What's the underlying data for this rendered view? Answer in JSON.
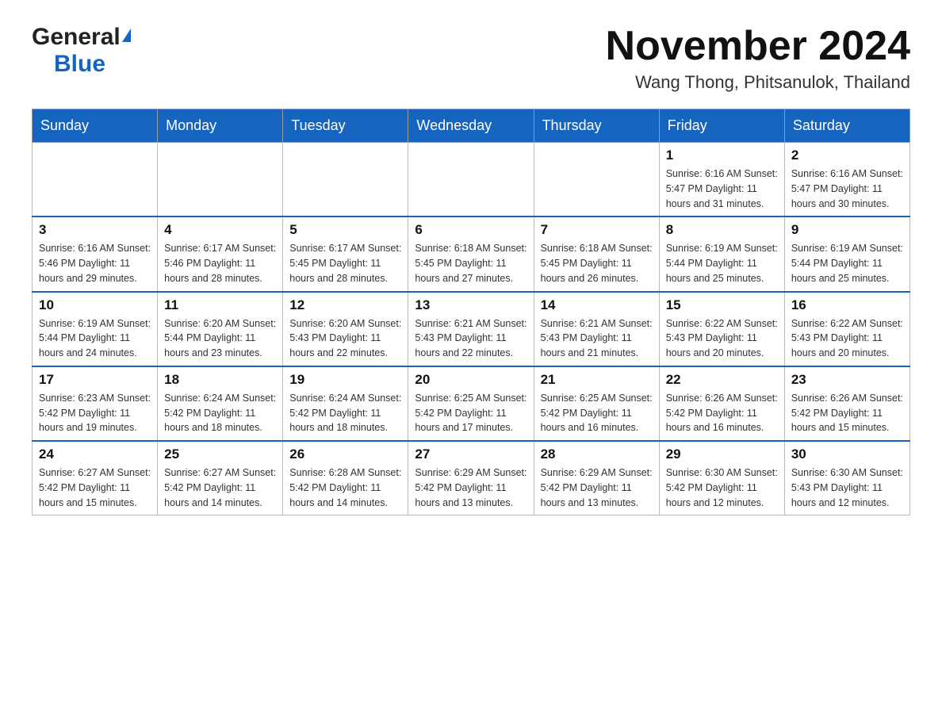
{
  "header": {
    "logo_general": "General",
    "logo_blue": "Blue",
    "month_title": "November 2024",
    "location": "Wang Thong, Phitsanulok, Thailand"
  },
  "weekdays": [
    "Sunday",
    "Monday",
    "Tuesday",
    "Wednesday",
    "Thursday",
    "Friday",
    "Saturday"
  ],
  "weeks": [
    [
      {
        "day": "",
        "info": ""
      },
      {
        "day": "",
        "info": ""
      },
      {
        "day": "",
        "info": ""
      },
      {
        "day": "",
        "info": ""
      },
      {
        "day": "",
        "info": ""
      },
      {
        "day": "1",
        "info": "Sunrise: 6:16 AM\nSunset: 5:47 PM\nDaylight: 11 hours\nand 31 minutes."
      },
      {
        "day": "2",
        "info": "Sunrise: 6:16 AM\nSunset: 5:47 PM\nDaylight: 11 hours\nand 30 minutes."
      }
    ],
    [
      {
        "day": "3",
        "info": "Sunrise: 6:16 AM\nSunset: 5:46 PM\nDaylight: 11 hours\nand 29 minutes."
      },
      {
        "day": "4",
        "info": "Sunrise: 6:17 AM\nSunset: 5:46 PM\nDaylight: 11 hours\nand 28 minutes."
      },
      {
        "day": "5",
        "info": "Sunrise: 6:17 AM\nSunset: 5:45 PM\nDaylight: 11 hours\nand 28 minutes."
      },
      {
        "day": "6",
        "info": "Sunrise: 6:18 AM\nSunset: 5:45 PM\nDaylight: 11 hours\nand 27 minutes."
      },
      {
        "day": "7",
        "info": "Sunrise: 6:18 AM\nSunset: 5:45 PM\nDaylight: 11 hours\nand 26 minutes."
      },
      {
        "day": "8",
        "info": "Sunrise: 6:19 AM\nSunset: 5:44 PM\nDaylight: 11 hours\nand 25 minutes."
      },
      {
        "day": "9",
        "info": "Sunrise: 6:19 AM\nSunset: 5:44 PM\nDaylight: 11 hours\nand 25 minutes."
      }
    ],
    [
      {
        "day": "10",
        "info": "Sunrise: 6:19 AM\nSunset: 5:44 PM\nDaylight: 11 hours\nand 24 minutes."
      },
      {
        "day": "11",
        "info": "Sunrise: 6:20 AM\nSunset: 5:44 PM\nDaylight: 11 hours\nand 23 minutes."
      },
      {
        "day": "12",
        "info": "Sunrise: 6:20 AM\nSunset: 5:43 PM\nDaylight: 11 hours\nand 22 minutes."
      },
      {
        "day": "13",
        "info": "Sunrise: 6:21 AM\nSunset: 5:43 PM\nDaylight: 11 hours\nand 22 minutes."
      },
      {
        "day": "14",
        "info": "Sunrise: 6:21 AM\nSunset: 5:43 PM\nDaylight: 11 hours\nand 21 minutes."
      },
      {
        "day": "15",
        "info": "Sunrise: 6:22 AM\nSunset: 5:43 PM\nDaylight: 11 hours\nand 20 minutes."
      },
      {
        "day": "16",
        "info": "Sunrise: 6:22 AM\nSunset: 5:43 PM\nDaylight: 11 hours\nand 20 minutes."
      }
    ],
    [
      {
        "day": "17",
        "info": "Sunrise: 6:23 AM\nSunset: 5:42 PM\nDaylight: 11 hours\nand 19 minutes."
      },
      {
        "day": "18",
        "info": "Sunrise: 6:24 AM\nSunset: 5:42 PM\nDaylight: 11 hours\nand 18 minutes."
      },
      {
        "day": "19",
        "info": "Sunrise: 6:24 AM\nSunset: 5:42 PM\nDaylight: 11 hours\nand 18 minutes."
      },
      {
        "day": "20",
        "info": "Sunrise: 6:25 AM\nSunset: 5:42 PM\nDaylight: 11 hours\nand 17 minutes."
      },
      {
        "day": "21",
        "info": "Sunrise: 6:25 AM\nSunset: 5:42 PM\nDaylight: 11 hours\nand 16 minutes."
      },
      {
        "day": "22",
        "info": "Sunrise: 6:26 AM\nSunset: 5:42 PM\nDaylight: 11 hours\nand 16 minutes."
      },
      {
        "day": "23",
        "info": "Sunrise: 6:26 AM\nSunset: 5:42 PM\nDaylight: 11 hours\nand 15 minutes."
      }
    ],
    [
      {
        "day": "24",
        "info": "Sunrise: 6:27 AM\nSunset: 5:42 PM\nDaylight: 11 hours\nand 15 minutes."
      },
      {
        "day": "25",
        "info": "Sunrise: 6:27 AM\nSunset: 5:42 PM\nDaylight: 11 hours\nand 14 minutes."
      },
      {
        "day": "26",
        "info": "Sunrise: 6:28 AM\nSunset: 5:42 PM\nDaylight: 11 hours\nand 14 minutes."
      },
      {
        "day": "27",
        "info": "Sunrise: 6:29 AM\nSunset: 5:42 PM\nDaylight: 11 hours\nand 13 minutes."
      },
      {
        "day": "28",
        "info": "Sunrise: 6:29 AM\nSunset: 5:42 PM\nDaylight: 11 hours\nand 13 minutes."
      },
      {
        "day": "29",
        "info": "Sunrise: 6:30 AM\nSunset: 5:42 PM\nDaylight: 11 hours\nand 12 minutes."
      },
      {
        "day": "30",
        "info": "Sunrise: 6:30 AM\nSunset: 5:43 PM\nDaylight: 11 hours\nand 12 minutes."
      }
    ]
  ]
}
